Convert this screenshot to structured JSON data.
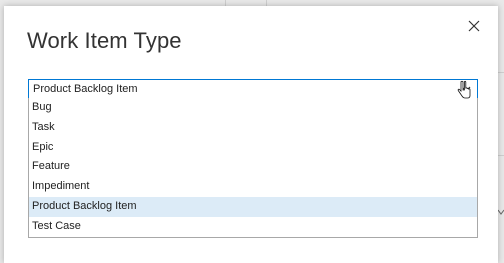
{
  "dialog": {
    "title": "Work Item Type",
    "close_icon": "close-icon",
    "select": {
      "value": "Product Backlog Item",
      "icon": "chevron-down-icon"
    },
    "options": [
      {
        "label": "Bug",
        "selected": false
      },
      {
        "label": "Task",
        "selected": false
      },
      {
        "label": "Epic",
        "selected": false
      },
      {
        "label": "Feature",
        "selected": false
      },
      {
        "label": "Impediment",
        "selected": false
      },
      {
        "label": "Product Backlog Item",
        "selected": true
      },
      {
        "label": "Test Case",
        "selected": false
      }
    ]
  },
  "colors": {
    "focus_border": "#0078d4",
    "selected_option": "#dcebf7",
    "title_text": "#333333"
  }
}
